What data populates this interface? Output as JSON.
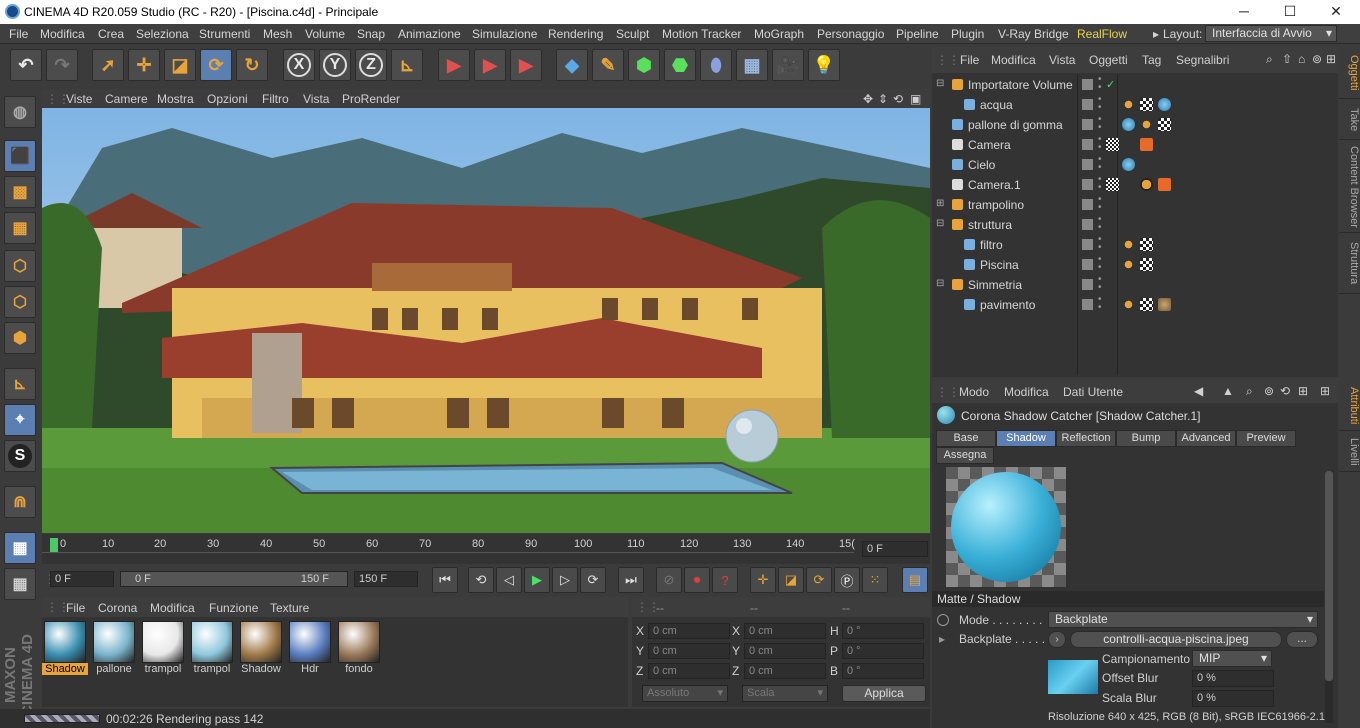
{
  "window": {
    "title": "CINEMA 4D R20.059 Studio (RC - R20) - [Piscina.c4d] - Principale",
    "controls": [
      "─",
      "☐",
      "✕"
    ]
  },
  "menu": [
    "File",
    "Modifica",
    "Crea",
    "Seleziona",
    "Strumenti",
    "Mesh",
    "Volume",
    "Snap",
    "Animazione",
    "Simulazione",
    "Rendering",
    "Sculpt",
    "Motion Tracker",
    "MoGraph",
    "Personaggio",
    "Pipeline",
    "Plugin",
    "V-Ray Bridge",
    "RealFlow"
  ],
  "layout": {
    "label": "Layout:",
    "value": "Interfaccia di Avvio"
  },
  "toolbar_axes": [
    "X",
    "Y",
    "Z"
  ],
  "viewport_menu": [
    "Viste",
    "Camere",
    "Mostra",
    "Opzioni",
    "Filtro",
    "Vista",
    "ProRender"
  ],
  "timeline": {
    "ticks": [
      "0",
      "10",
      "20",
      "30",
      "40",
      "50",
      "60",
      "70",
      "80",
      "90",
      "100",
      "110",
      "120",
      "130",
      "140",
      "15("
    ],
    "current_frame": "0 F"
  },
  "playback": {
    "start": "0 F",
    "range_start": "0 F",
    "range_end": "150 F",
    "end": "150 F"
  },
  "material_menu": [
    "File",
    "Corona",
    "Modifica",
    "Funzione",
    "Texture"
  ],
  "materials": [
    {
      "name": "Shadow",
      "color": "#3a8fb0",
      "selected": true
    },
    {
      "name": "pallone",
      "color": "#7ab4cc",
      "selected": false
    },
    {
      "name": "trampol",
      "color": "#e8e8e8",
      "selected": false
    },
    {
      "name": "trampol",
      "color": "#8ec8dc",
      "selected": false
    },
    {
      "name": "Shadow",
      "color": "#a07a4a",
      "selected": false
    },
    {
      "name": "Hdr",
      "color": "#5a7ec0",
      "selected": false
    },
    {
      "name": "fondo",
      "color": "#9a7a5a",
      "selected": false
    }
  ],
  "coords": {
    "headers": [
      "--",
      "--",
      "--"
    ],
    "rows": [
      {
        "a_label": "X",
        "a_val": "0 cm",
        "b_label": "X",
        "b_val": "0 cm",
        "c_label": "H",
        "c_val": "0 °"
      },
      {
        "a_label": "Y",
        "a_val": "0 cm",
        "b_label": "Y",
        "b_val": "0 cm",
        "c_label": "P",
        "c_val": "0 °"
      },
      {
        "a_label": "Z",
        "a_val": "0 cm",
        "b_label": "Z",
        "b_val": "0 cm",
        "c_label": "B",
        "c_val": "0 °"
      }
    ],
    "mode": "Assoluto",
    "scale": "Scala",
    "apply": "Applica"
  },
  "status": "00:02:26 Rendering pass 142",
  "object_menu": [
    "File",
    "Modifica",
    "Vista",
    "Oggetti",
    "Tag",
    "Segnalibri"
  ],
  "objects": [
    {
      "name": "Importatore Volume",
      "indent": 0,
      "icon_color": "#e8a33a"
    },
    {
      "name": "acqua",
      "indent": 1,
      "icon_color": "#7ab0e0"
    },
    {
      "name": "pallone di gomma",
      "indent": 0,
      "icon_color": "#7ab0e0"
    },
    {
      "name": "Camera",
      "indent": 0,
      "icon_color": "#dddddd"
    },
    {
      "name": "Cielo",
      "indent": 0,
      "icon_color": "#7ab0e0"
    },
    {
      "name": "Camera.1",
      "indent": 0,
      "icon_color": "#dddddd"
    },
    {
      "name": "trampolino",
      "indent": 0,
      "icon_color": "#e8a33a"
    },
    {
      "name": "struttura",
      "indent": 0,
      "icon_color": "#e8a33a"
    },
    {
      "name": "filtro",
      "indent": 1,
      "icon_color": "#7ab0e0"
    },
    {
      "name": "Piscina",
      "indent": 1,
      "icon_color": "#7ab0e0"
    },
    {
      "name": "Simmetria",
      "indent": 0,
      "icon_color": "#e8a33a"
    },
    {
      "name": "pavimento",
      "indent": 1,
      "icon_color": "#7ab0e0"
    }
  ],
  "attr_menu": [
    "Modo",
    "Modifica",
    "Dati Utente"
  ],
  "attr_title": "Corona Shadow Catcher [Shadow Catcher.1]",
  "attr_tabs": [
    "Base",
    "Shadow",
    "Reflection",
    "Bump",
    "Advanced",
    "Preview"
  ],
  "attr_tab2": "Assegna",
  "section": "Matte / Shadow",
  "props": {
    "mode_label": "Mode . . . . . . . .",
    "mode_value": "Backplate",
    "backplate_label": "Backplate . . . . .",
    "backplate_value": "controlli-acqua-piscina.jpeg",
    "browse": "...",
    "sampling_label": "Campionamento",
    "sampling_value": "MIP",
    "offset_label": "Offset Blur",
    "offset_value": "0 %",
    "scale_label": "Scala Blur",
    "scale_value": "0 %",
    "resolution": "Risoluzione 640 x 425, RGB (8 Bit), sRGB IEC61966-2.1"
  },
  "side_tabs_top": [
    "Oggetti",
    "Take",
    "Content Browser",
    "Struttura"
  ],
  "side_tabs_bottom": [
    "Attributi",
    "Livelli"
  ],
  "colors": {
    "accent": "#5b7fb3",
    "highlight": "#e8a33a",
    "realflow": "#e8d44a"
  }
}
